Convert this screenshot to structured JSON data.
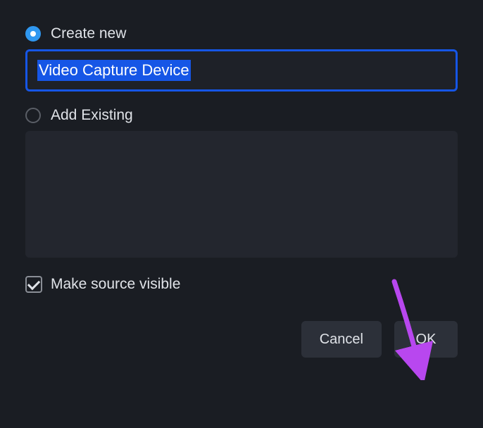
{
  "radios": {
    "create_new": {
      "label": "Create new",
      "selected": true
    },
    "add_existing": {
      "label": "Add Existing",
      "selected": false
    }
  },
  "name_input": {
    "value": "Video Capture Device",
    "selected": true
  },
  "checkbox": {
    "make_visible": {
      "label": "Make source visible",
      "checked": true
    }
  },
  "buttons": {
    "cancel": "Cancel",
    "ok": "OK"
  }
}
